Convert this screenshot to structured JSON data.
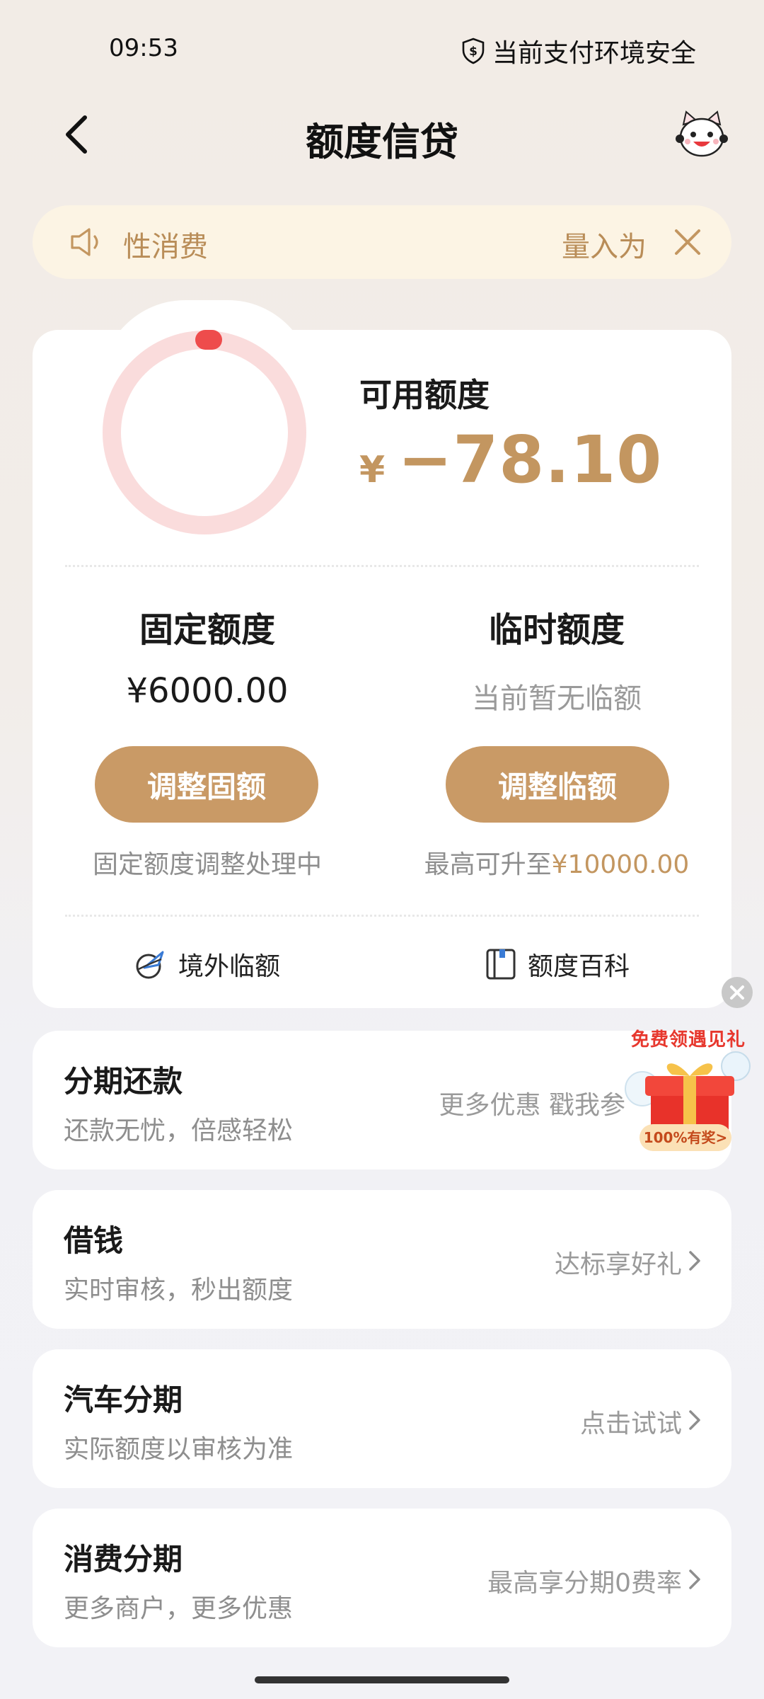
{
  "status_bar": {
    "time": "09:53",
    "security_text": "当前支付环境安全"
  },
  "nav": {
    "title": "额度信贷"
  },
  "notice": {
    "text": "性消费",
    "text_right": "量入为"
  },
  "credit": {
    "available_label": "可用额度",
    "currency": "¥",
    "available_value": "−78.10",
    "used_fraction": 1.0,
    "fixed": {
      "title": "固定额度",
      "value": "¥6000.00",
      "button": "调整固额",
      "note": "固定额度调整处理中"
    },
    "temporary": {
      "title": "临时额度",
      "value": "当前暂无临额",
      "button": "调整临额",
      "note_prefix": "最高可升至",
      "note_highlight": "¥10000.00"
    },
    "links": [
      {
        "label": "境外临额",
        "icon": "plane-globe-icon"
      },
      {
        "label": "额度百科",
        "icon": "book-icon"
      }
    ]
  },
  "services": [
    {
      "title": "分期还款",
      "subtitle": "还款无忧，倍感轻松",
      "right": "更多优惠 戳我参"
    },
    {
      "title": "借钱",
      "subtitle": "实时审核，秒出额度",
      "right": "达标享好礼"
    },
    {
      "title": "汽车分期",
      "subtitle": "实际额度以审核为准",
      "right": "点击试试"
    },
    {
      "title": "消费分期",
      "subtitle": "更多商户，更多优惠",
      "right": "最高享分期0费率"
    }
  ],
  "gift": {
    "banner": "免费领遇见礼",
    "tag": "100%有奖>"
  },
  "colors": {
    "accent": "#c99a66",
    "accent_text": "#c39660",
    "ring": "#fadcdc",
    "ring_dot": "#ee4c4c"
  }
}
